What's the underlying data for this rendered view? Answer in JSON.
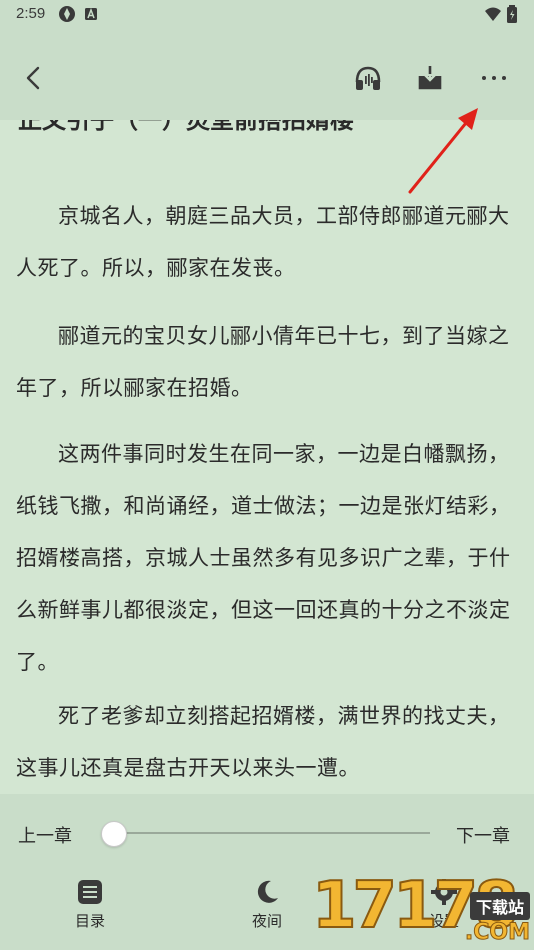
{
  "status_bar": {
    "time": "2:59"
  },
  "reader": {
    "chapter_title": "正文引子（一）灵堂前搭招婿楼",
    "paragraphs": [
      "京城名人，朝庭三品大员，工部侍郎郦道元郦大人死了。所以，郦家在发丧。",
      "郦道元的宝贝女儿郦小倩年已十七，到了当嫁之年了，所以郦家在招婚。",
      "这两件事同时发生在同一家，一边是白幡飘扬，纸钱飞撒，和尚诵经，道士做法；一边是张灯结彩，招婿楼高搭，京城人士虽然多有见多识广之辈，于什么新鲜事儿都很淡定，但这一回还真的十分之不淡定了。",
      "死了老爹却立刻搭起招婿楼，满世界的找丈夫，这事儿还真是盘古开天以来头一遭。"
    ]
  },
  "chapter_nav": {
    "prev_label": "上一章",
    "next_label": "下一章",
    "progress": 0
  },
  "tabs": [
    {
      "label": "目录",
      "icon": "list-icon"
    },
    {
      "label": "夜间",
      "icon": "moon-icon"
    },
    {
      "label": "设置",
      "icon": "gear-icon"
    }
  ],
  "watermark": {
    "digits": "17178",
    "tag": "下载站",
    "dotcom": ".COM"
  },
  "colors": {
    "background": "#d3e6d2",
    "bar": "#c9ddc9",
    "annotation_arrow": "#e0221a"
  }
}
